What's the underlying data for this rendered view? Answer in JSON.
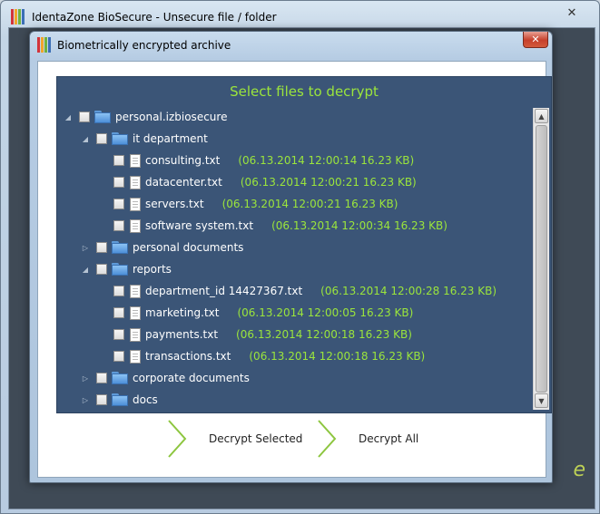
{
  "outer_window": {
    "title": "IdentaZone BioSecure - Unsecure file / folder",
    "close_label": "✕",
    "background_hint": "e"
  },
  "inner_window": {
    "title": "Biometrically encrypted archive",
    "close_label": "✕"
  },
  "panel": {
    "title": "Select files to decrypt"
  },
  "tree": [
    {
      "level": 0,
      "type": "folder",
      "expander": "◢",
      "name": "personal.izbiosecure",
      "info": ""
    },
    {
      "level": 1,
      "type": "folder",
      "expander": "◢",
      "name": "it department",
      "info": ""
    },
    {
      "level": 2,
      "type": "file",
      "expander": "",
      "name": "consulting.txt",
      "info": "(06.13.2014 12:00:14  16.23 KB)"
    },
    {
      "level": 2,
      "type": "file",
      "expander": "",
      "name": "datacenter.txt",
      "info": "(06.13.2014 12:00:21  16.23 KB)"
    },
    {
      "level": 2,
      "type": "file",
      "expander": "",
      "name": "servers.txt",
      "info": "(06.13.2014 12:00:21  16.23 KB)"
    },
    {
      "level": 2,
      "type": "file",
      "expander": "",
      "name": "software system.txt",
      "info": "(06.13.2014 12:00:34  16.23 KB)"
    },
    {
      "level": 1,
      "type": "folder",
      "expander": "▷",
      "name": "personal documents",
      "info": ""
    },
    {
      "level": 1,
      "type": "folder",
      "expander": "◢",
      "name": "reports",
      "info": ""
    },
    {
      "level": 2,
      "type": "file",
      "expander": "",
      "name": "department_id 14427367.txt",
      "info": "(06.13.2014 12:00:28  16.23 KB)"
    },
    {
      "level": 2,
      "type": "file",
      "expander": "",
      "name": "marketing.txt",
      "info": "(06.13.2014 12:00:05  16.23 KB)"
    },
    {
      "level": 2,
      "type": "file",
      "expander": "",
      "name": "payments.txt",
      "info": "(06.13.2014 12:00:18  16.23 KB)"
    },
    {
      "level": 2,
      "type": "file",
      "expander": "",
      "name": "transactions.txt",
      "info": "(06.13.2014 12:00:18  16.23 KB)"
    },
    {
      "level": 1,
      "type": "folder",
      "expander": "▷",
      "name": "corporate documents",
      "info": ""
    },
    {
      "level": 1,
      "type": "folder",
      "expander": "▷",
      "name": "docs",
      "info": ""
    }
  ],
  "scrollbar": {
    "up_arrow": "▲",
    "down_arrow": "▼"
  },
  "actions": {
    "decrypt_selected": "Decrypt Selected",
    "decrypt_all": "Decrypt All"
  },
  "colors": {
    "panel_background": "#3b5577",
    "accent_green": "#9be53c",
    "chevron_green": "#8dc63f",
    "close_red": "#c6402b"
  }
}
